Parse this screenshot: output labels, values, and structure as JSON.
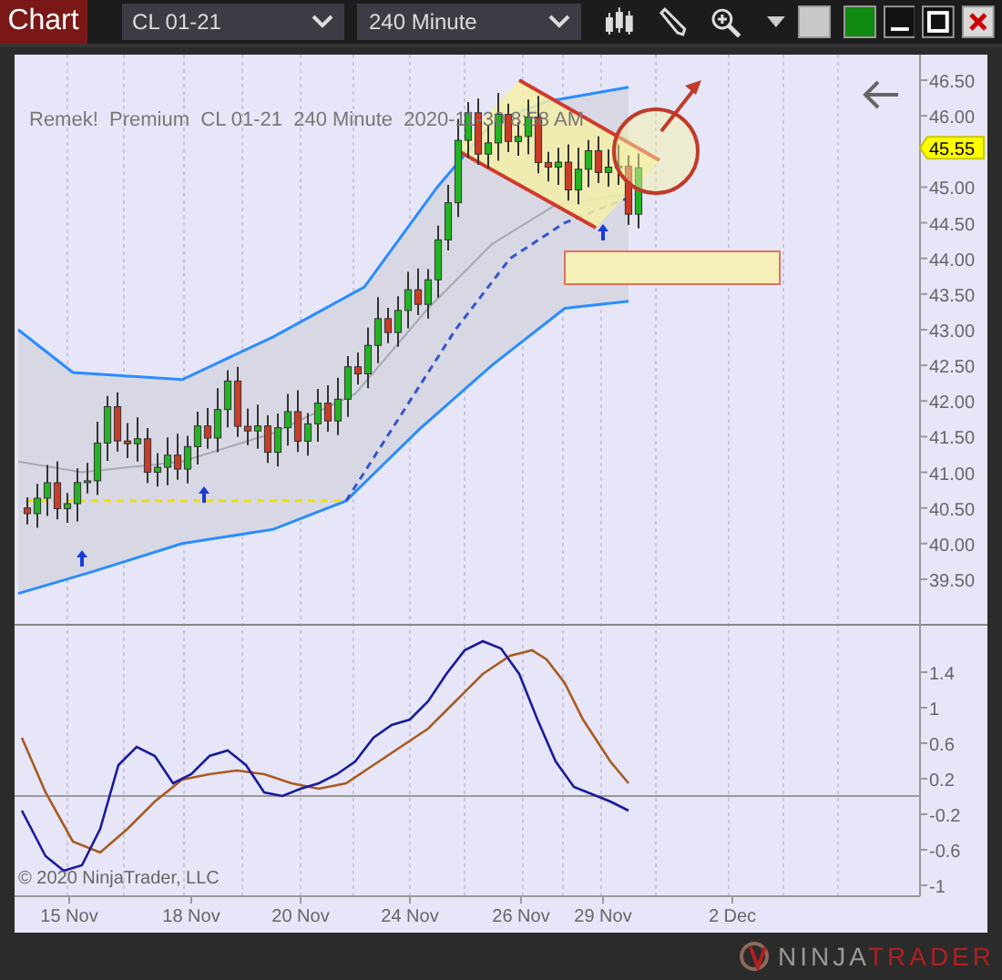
{
  "toolbar": {
    "title": "Chart",
    "instrument": {
      "value": "CL 01-21"
    },
    "interval": {
      "value": "240 Minute"
    }
  },
  "chart": {
    "label": "Remek!  Premium  CL 01-21  240 Minute  2020-11-30 8:58 AM",
    "price_axis": [
      "46.50",
      "46.00",
      "45.00",
      "44.50",
      "44.00",
      "43.50",
      "43.00",
      "42.50",
      "42.00",
      "41.50",
      "41.00",
      "40.50",
      "40.00",
      "39.50"
    ],
    "current_price": "45.55",
    "oscillator_axis": [
      "1.4",
      "1",
      "0.6",
      "0.2",
      "-0.2",
      "-0.6",
      "-1"
    ],
    "date_axis": [
      "15 Nov",
      "18 Nov",
      "20 Nov",
      "24 Nov",
      "26 Nov",
      "29 Nov",
      "2 Dec"
    ],
    "copyright": "© 2020 NinjaTrader, LLC"
  },
  "logo": {
    "first": "NINJA",
    "second": "TRADER"
  }
}
